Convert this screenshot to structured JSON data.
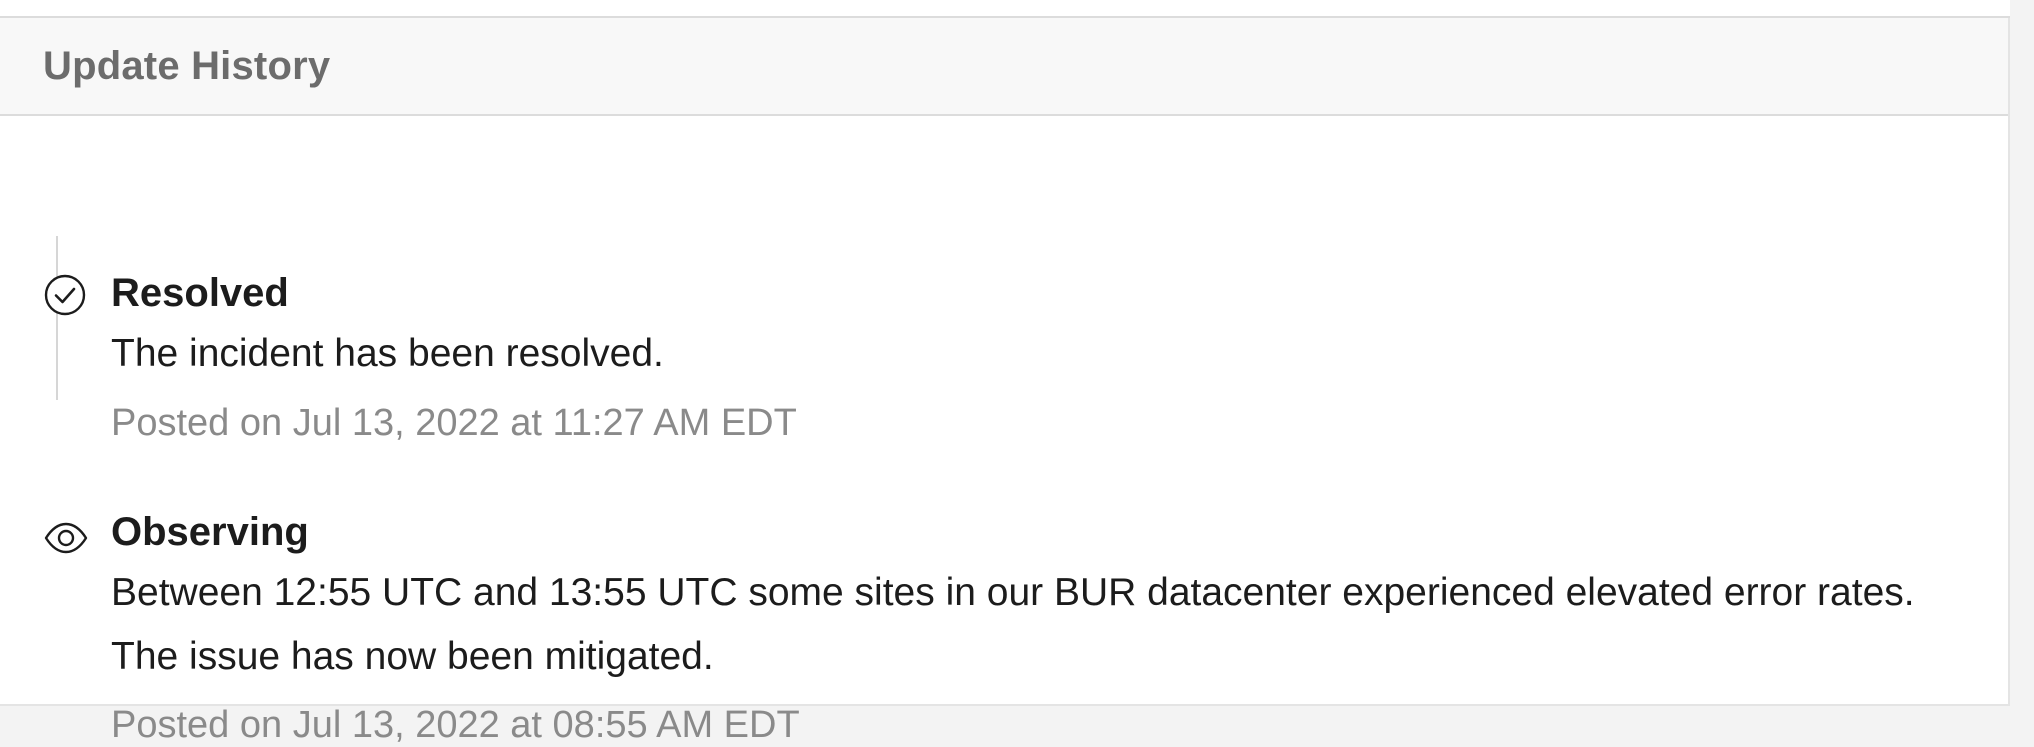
{
  "section": {
    "title": "Update History"
  },
  "updates": [
    {
      "status": "Resolved",
      "icon": "check-circle-icon",
      "message": "The incident has been resolved.",
      "posted": "Posted on Jul 13, 2022 at 11:27 AM EDT"
    },
    {
      "status": "Observing",
      "icon": "eye-icon",
      "message": "Between 12:55 UTC and 13:55 UTC some sites in our BUR datacenter experienced elevated error rates.  The issue has now been mitigated.",
      "posted": "Posted on Jul 13, 2022 at 08:55 AM EDT"
    }
  ],
  "colors": {
    "text": "#1c1c1c",
    "muted": "#8a8a8a",
    "header_bg": "#f8f8f8",
    "border": "#dcdcdc"
  }
}
